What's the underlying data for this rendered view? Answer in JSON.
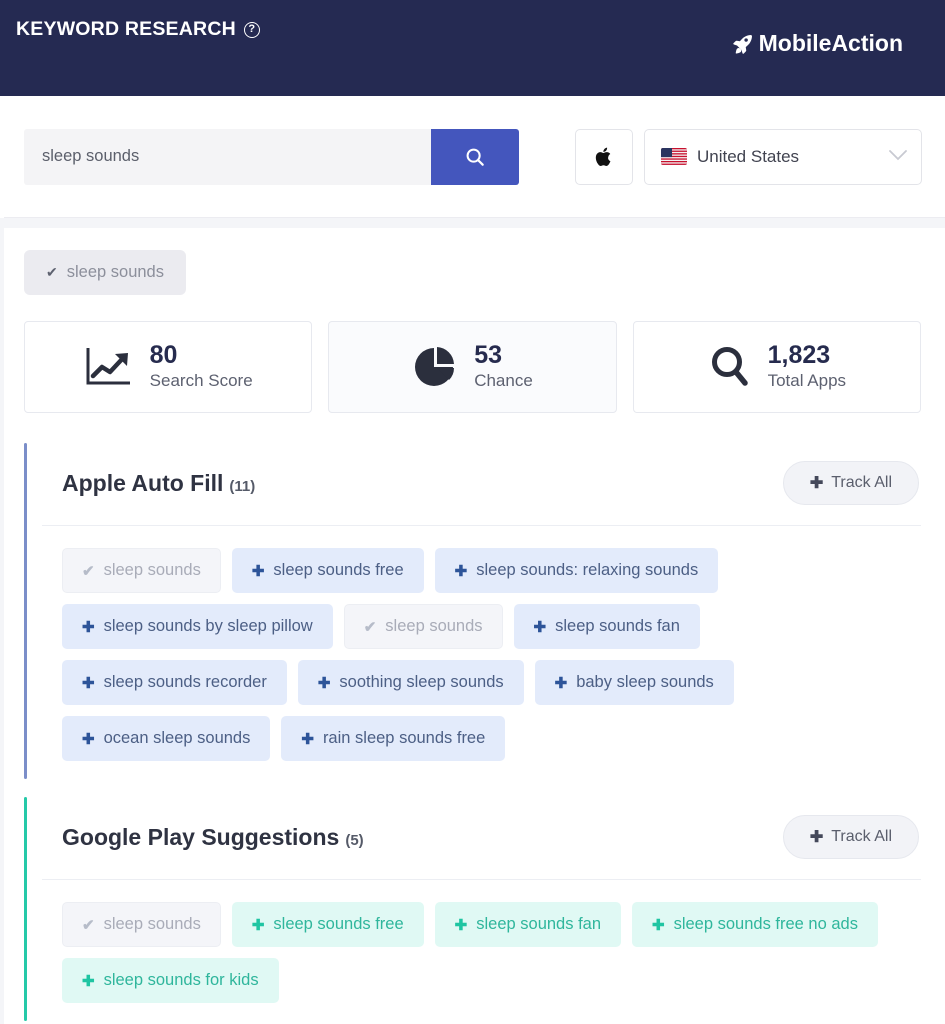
{
  "header": {
    "title": "KEYWORD RESEARCH",
    "help_icon": "question-mark-circle-icon",
    "brand": "MobileAction",
    "brand_icon": "rocket-icon",
    "background_color": "#252a52"
  },
  "search": {
    "value": "sleep sounds",
    "placeholder": "Search keyword",
    "button_icon": "search-icon",
    "button_color": "#4456bd",
    "platform_icon": "apple-icon",
    "country": "United States",
    "country_flag": "us-flag-icon",
    "dropdown_icon": "chevron-down-icon"
  },
  "keyword_tag": {
    "label": "sleep sounds",
    "icon": "check-icon"
  },
  "metrics": [
    {
      "value": "80",
      "label": "Search Score",
      "icon": "line-chart-icon"
    },
    {
      "value": "53",
      "label": "Chance",
      "icon": "pie-chart-icon"
    },
    {
      "value": "1,823",
      "label": "Total Apps",
      "icon": "magnifier-icon"
    }
  ],
  "sections": [
    {
      "title": "Apple Auto Fill",
      "count": "(11)",
      "accent_color": "#7b8ec9",
      "track_all_label": "Track All",
      "track_all_icon": "plus-icon",
      "chips": [
        {
          "label": "sleep sounds",
          "state": "tracked",
          "icon": "check-icon"
        },
        {
          "label": "sleep sounds free",
          "state": "addable",
          "icon": "plus-icon"
        },
        {
          "label": "sleep sounds: relaxing sounds",
          "state": "addable",
          "icon": "plus-icon"
        },
        {
          "label": "sleep sounds by sleep pillow",
          "state": "addable",
          "icon": "plus-icon"
        },
        {
          "label": "sleep sounds",
          "state": "tracked",
          "icon": "check-icon"
        },
        {
          "label": "sleep sounds fan",
          "state": "addable",
          "icon": "plus-icon"
        },
        {
          "label": "sleep sounds recorder",
          "state": "addable",
          "icon": "plus-icon"
        },
        {
          "label": "soothing sleep sounds",
          "state": "addable",
          "icon": "plus-icon"
        },
        {
          "label": "baby sleep sounds",
          "state": "addable",
          "icon": "plus-icon"
        },
        {
          "label": "ocean sleep sounds",
          "state": "addable",
          "icon": "plus-icon"
        },
        {
          "label": "rain sleep sounds free",
          "state": "addable",
          "icon": "plus-icon"
        }
      ]
    },
    {
      "title": "Google Play Suggestions",
      "count": "(5)",
      "accent_color": "#25c9a8",
      "track_all_label": "Track All",
      "track_all_icon": "plus-icon",
      "chips": [
        {
          "label": "sleep sounds",
          "state": "tracked",
          "icon": "check-icon"
        },
        {
          "label": "sleep sounds free",
          "state": "addable",
          "icon": "plus-icon"
        },
        {
          "label": "sleep sounds fan",
          "state": "addable",
          "icon": "plus-icon"
        },
        {
          "label": "sleep sounds free no ads",
          "state": "addable",
          "icon": "plus-icon"
        },
        {
          "label": "sleep sounds for kids",
          "state": "addable",
          "icon": "plus-icon"
        }
      ]
    }
  ]
}
